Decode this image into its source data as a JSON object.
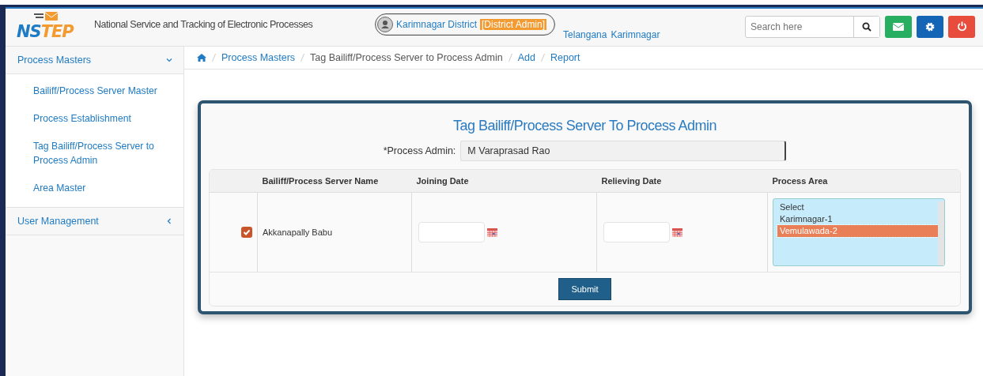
{
  "header": {
    "logo": "NSTEP",
    "title": "National Service and Tracking of Electronic Processes",
    "user": {
      "name": "Karimnagar District",
      "role": "[District Admin]"
    },
    "state": "Telangana",
    "district": "Karimnagar",
    "search": {
      "placeholder": "Search here"
    }
  },
  "sidebar": {
    "items": [
      {
        "label": "Process Masters",
        "expanded": true,
        "children": [
          {
            "label": "Bailiff/Process Server Master",
            "selected": false
          },
          {
            "label": "Process Establishment",
            "selected": false
          },
          {
            "label": "Tag Bailiff/Process Server to Process Admin",
            "selected": false
          },
          {
            "label": "Area Master",
            "selected": false
          }
        ]
      },
      {
        "label": "User Management",
        "expanded": false
      }
    ]
  },
  "breadcrumb": [
    {
      "label": "Process Masters",
      "kind": "link"
    },
    {
      "label": "Tag Bailiff/Process Server to Process Admin",
      "kind": "text"
    },
    {
      "label": "Add",
      "kind": "link"
    },
    {
      "label": "Report",
      "kind": "link"
    }
  ],
  "form": {
    "title": "Tag Bailiff/Process Server To Process Admin",
    "admin_label": "*Process Admin:",
    "admin_value": "M Varaprasad Rao",
    "columns": [
      "Bailiff/Process Server Name",
      "Joining Date",
      "Relieving Date",
      "Process Area"
    ],
    "rows": [
      {
        "checked": true,
        "name": "Akkanapally Babu",
        "areas": [
          {
            "label": "Select",
            "selected": false
          },
          {
            "label": "Karimnagar-1",
            "selected": false
          },
          {
            "label": "Vemulawada-2",
            "selected": true
          }
        ]
      }
    ],
    "submit": "Submit"
  }
}
